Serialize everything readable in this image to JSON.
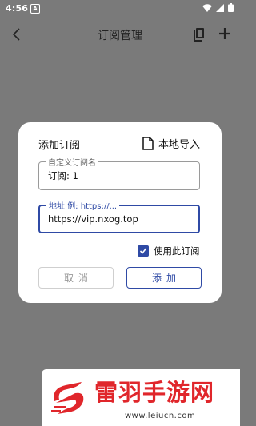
{
  "status_bar": {
    "time": "4:56",
    "app_badge": "A"
  },
  "top_bar": {
    "title": "订阅管理"
  },
  "dialog": {
    "title": "添加订阅",
    "import_label": "本地导入",
    "name_field": {
      "label": "自定义订阅名",
      "value": "订阅: 1"
    },
    "url_field": {
      "label": "地址 例: https://...",
      "value": "https://vip.nxog.top"
    },
    "use_checkbox": {
      "label": "使用此订阅",
      "checked": true
    },
    "cancel_label": "取消",
    "add_label": "添加"
  },
  "watermark": {
    "title": "雷羽手游网",
    "url": "www.leiucn.com"
  },
  "colors": {
    "accent": "#2f4aa5",
    "scrim": "#7a7a7a",
    "watermark_red": "#e0262b"
  }
}
